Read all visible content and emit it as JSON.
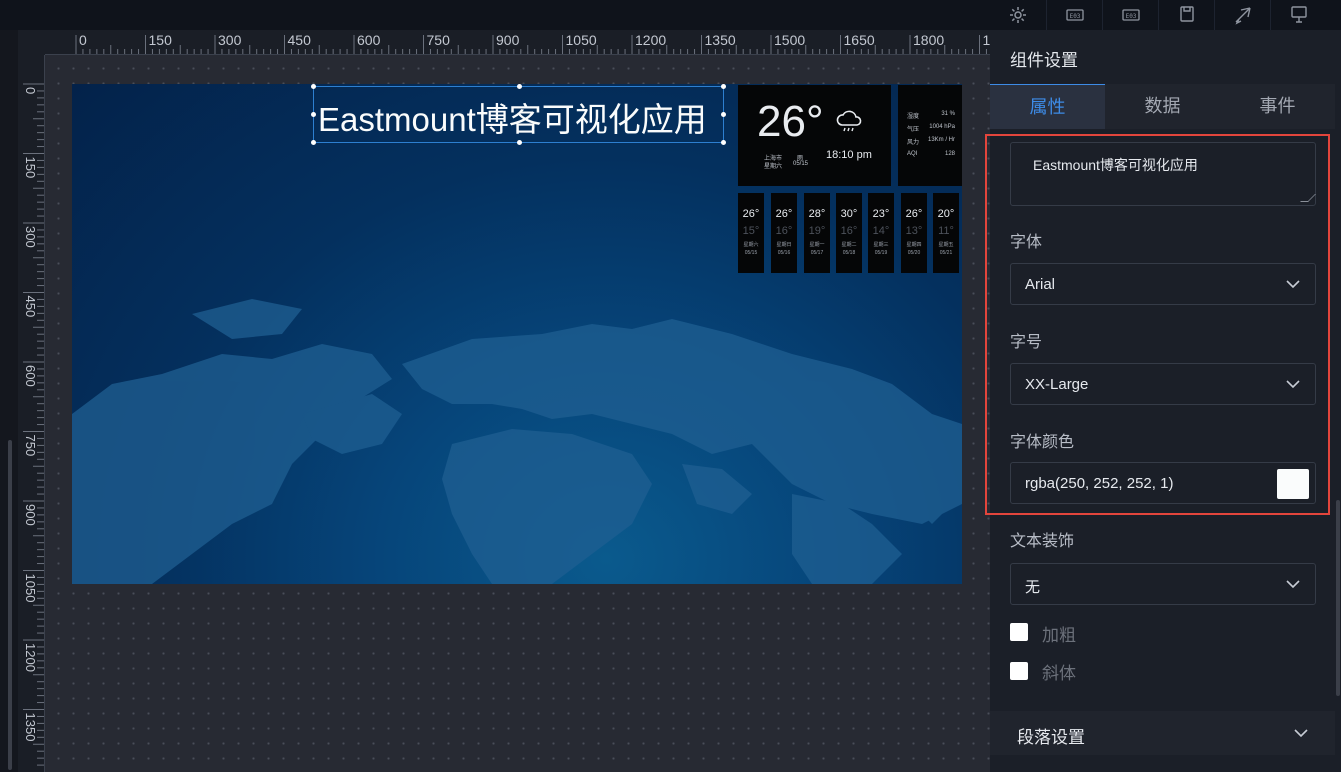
{
  "toolbar": {
    "icons": [
      "gear-icon",
      "code-icon",
      "code-icon",
      "save-icon",
      "publish-icon",
      "preview-icon"
    ]
  },
  "ruler": {
    "h_labels": [
      "0",
      "150",
      "300",
      "450",
      "600",
      "750",
      "900",
      "1050",
      "1200",
      "1350",
      "1500",
      "1650",
      "1800",
      "1"
    ],
    "v_labels": [
      "0",
      "150",
      "300",
      "450",
      "600",
      "750",
      "900",
      "1050",
      "1200",
      "1350"
    ]
  },
  "canvas": {
    "title_text": "Eastmount博客可视化应用",
    "weather": {
      "temperature": "26°",
      "city": "上海市",
      "condition": "雨",
      "weekday": "星期六",
      "date": "05/15",
      "time": "18:10 pm",
      "details": [
        {
          "label": "湿度",
          "value": "31 %"
        },
        {
          "label": "气压",
          "value": "1004 hPa"
        },
        {
          "label": "风力",
          "value": "13Km / Hr"
        },
        {
          "label": "AQI",
          "value": "128"
        }
      ],
      "forecast": [
        {
          "hi": "26°",
          "lo": "15°",
          "weekday": "星期六",
          "date": "05/15"
        },
        {
          "hi": "26°",
          "lo": "16°",
          "weekday": "星期日",
          "date": "05/16"
        },
        {
          "hi": "28°",
          "lo": "19°",
          "weekday": "星期一",
          "date": "05/17"
        },
        {
          "hi": "30°",
          "lo": "16°",
          "weekday": "星期二",
          "date": "05/18"
        },
        {
          "hi": "23°",
          "lo": "14°",
          "weekday": "星期三",
          "date": "05/19"
        },
        {
          "hi": "26°",
          "lo": "13°",
          "weekday": "星期四",
          "date": "05/20"
        },
        {
          "hi": "20°",
          "lo": "11°",
          "weekday": "星期五",
          "date": "05/21"
        }
      ]
    }
  },
  "panel": {
    "title": "组件设置",
    "tabs": [
      "属性",
      "数据",
      "事件"
    ],
    "active_tab": "属性",
    "text_value": "Eastmount博客可视化应用",
    "font_label": "字体",
    "font_value": "Arial",
    "size_label": "字号",
    "size_value": "XX-Large",
    "color_label": "字体颜色",
    "color_value": "rgba(250, 252, 252, 1)",
    "decoration_label": "文本装饰",
    "decoration_value": "无",
    "bold_label": "加粗",
    "italic_label": "斜体",
    "paragraph_section": "段落设置"
  },
  "colors": {
    "accent": "#3d8be6",
    "highlight_border": "#e3453c",
    "font_color": "#fafcfc"
  }
}
